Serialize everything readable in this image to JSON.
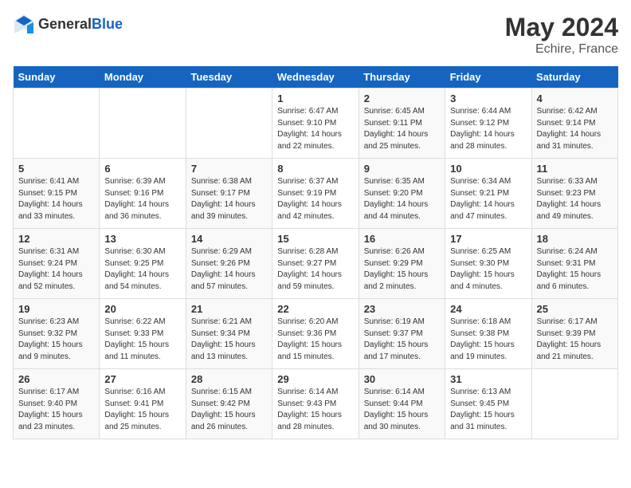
{
  "header": {
    "logo_general": "General",
    "logo_blue": "Blue",
    "title": "May 2024",
    "location": "Echire, France"
  },
  "days_of_week": [
    "Sunday",
    "Monday",
    "Tuesday",
    "Wednesday",
    "Thursday",
    "Friday",
    "Saturday"
  ],
  "weeks": [
    [
      {
        "day": "",
        "info": ""
      },
      {
        "day": "",
        "info": ""
      },
      {
        "day": "",
        "info": ""
      },
      {
        "day": "1",
        "info": "Sunrise: 6:47 AM\nSunset: 9:10 PM\nDaylight: 14 hours\nand 22 minutes."
      },
      {
        "day": "2",
        "info": "Sunrise: 6:45 AM\nSunset: 9:11 PM\nDaylight: 14 hours\nand 25 minutes."
      },
      {
        "day": "3",
        "info": "Sunrise: 6:44 AM\nSunset: 9:12 PM\nDaylight: 14 hours\nand 28 minutes."
      },
      {
        "day": "4",
        "info": "Sunrise: 6:42 AM\nSunset: 9:14 PM\nDaylight: 14 hours\nand 31 minutes."
      }
    ],
    [
      {
        "day": "5",
        "info": "Sunrise: 6:41 AM\nSunset: 9:15 PM\nDaylight: 14 hours\nand 33 minutes."
      },
      {
        "day": "6",
        "info": "Sunrise: 6:39 AM\nSunset: 9:16 PM\nDaylight: 14 hours\nand 36 minutes."
      },
      {
        "day": "7",
        "info": "Sunrise: 6:38 AM\nSunset: 9:17 PM\nDaylight: 14 hours\nand 39 minutes."
      },
      {
        "day": "8",
        "info": "Sunrise: 6:37 AM\nSunset: 9:19 PM\nDaylight: 14 hours\nand 42 minutes."
      },
      {
        "day": "9",
        "info": "Sunrise: 6:35 AM\nSunset: 9:20 PM\nDaylight: 14 hours\nand 44 minutes."
      },
      {
        "day": "10",
        "info": "Sunrise: 6:34 AM\nSunset: 9:21 PM\nDaylight: 14 hours\nand 47 minutes."
      },
      {
        "day": "11",
        "info": "Sunrise: 6:33 AM\nSunset: 9:23 PM\nDaylight: 14 hours\nand 49 minutes."
      }
    ],
    [
      {
        "day": "12",
        "info": "Sunrise: 6:31 AM\nSunset: 9:24 PM\nDaylight: 14 hours\nand 52 minutes."
      },
      {
        "day": "13",
        "info": "Sunrise: 6:30 AM\nSunset: 9:25 PM\nDaylight: 14 hours\nand 54 minutes."
      },
      {
        "day": "14",
        "info": "Sunrise: 6:29 AM\nSunset: 9:26 PM\nDaylight: 14 hours\nand 57 minutes."
      },
      {
        "day": "15",
        "info": "Sunrise: 6:28 AM\nSunset: 9:27 PM\nDaylight: 14 hours\nand 59 minutes."
      },
      {
        "day": "16",
        "info": "Sunrise: 6:26 AM\nSunset: 9:29 PM\nDaylight: 15 hours\nand 2 minutes."
      },
      {
        "day": "17",
        "info": "Sunrise: 6:25 AM\nSunset: 9:30 PM\nDaylight: 15 hours\nand 4 minutes."
      },
      {
        "day": "18",
        "info": "Sunrise: 6:24 AM\nSunset: 9:31 PM\nDaylight: 15 hours\nand 6 minutes."
      }
    ],
    [
      {
        "day": "19",
        "info": "Sunrise: 6:23 AM\nSunset: 9:32 PM\nDaylight: 15 hours\nand 9 minutes."
      },
      {
        "day": "20",
        "info": "Sunrise: 6:22 AM\nSunset: 9:33 PM\nDaylight: 15 hours\nand 11 minutes."
      },
      {
        "day": "21",
        "info": "Sunrise: 6:21 AM\nSunset: 9:34 PM\nDaylight: 15 hours\nand 13 minutes."
      },
      {
        "day": "22",
        "info": "Sunrise: 6:20 AM\nSunset: 9:36 PM\nDaylight: 15 hours\nand 15 minutes."
      },
      {
        "day": "23",
        "info": "Sunrise: 6:19 AM\nSunset: 9:37 PM\nDaylight: 15 hours\nand 17 minutes."
      },
      {
        "day": "24",
        "info": "Sunrise: 6:18 AM\nSunset: 9:38 PM\nDaylight: 15 hours\nand 19 minutes."
      },
      {
        "day": "25",
        "info": "Sunrise: 6:17 AM\nSunset: 9:39 PM\nDaylight: 15 hours\nand 21 minutes."
      }
    ],
    [
      {
        "day": "26",
        "info": "Sunrise: 6:17 AM\nSunset: 9:40 PM\nDaylight: 15 hours\nand 23 minutes."
      },
      {
        "day": "27",
        "info": "Sunrise: 6:16 AM\nSunset: 9:41 PM\nDaylight: 15 hours\nand 25 minutes."
      },
      {
        "day": "28",
        "info": "Sunrise: 6:15 AM\nSunset: 9:42 PM\nDaylight: 15 hours\nand 26 minutes."
      },
      {
        "day": "29",
        "info": "Sunrise: 6:14 AM\nSunset: 9:43 PM\nDaylight: 15 hours\nand 28 minutes."
      },
      {
        "day": "30",
        "info": "Sunrise: 6:14 AM\nSunset: 9:44 PM\nDaylight: 15 hours\nand 30 minutes."
      },
      {
        "day": "31",
        "info": "Sunrise: 6:13 AM\nSunset: 9:45 PM\nDaylight: 15 hours\nand 31 minutes."
      },
      {
        "day": "",
        "info": ""
      }
    ]
  ]
}
